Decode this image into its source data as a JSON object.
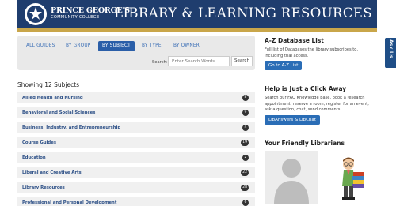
{
  "header": {
    "logo_name": "PRINCE GEORGE'S",
    "logo_subtitle": "COMMUNITY COLLEGE",
    "site_title": "LIBRARY & LEARNING RESOURCES",
    "colors": {
      "header_bg": "#1f3d6e",
      "accent_gold": "#c9a64a"
    }
  },
  "filter": {
    "tabs": [
      {
        "label": "ALL GUIDES"
      },
      {
        "label": "BY GROUP"
      },
      {
        "label": "BY SUBJECT",
        "active": true
      },
      {
        "label": "BY TYPE"
      },
      {
        "label": "BY OWNER"
      }
    ],
    "search_label": "Search:",
    "search_placeholder": "Enter Search Words",
    "search_button": "Search"
  },
  "subjects": {
    "heading": "Showing 12 Subjects",
    "items": [
      {
        "label": "Allied Health and Nursing",
        "count": "8"
      },
      {
        "label": "Behavioral and Social Sciences",
        "count": "9"
      },
      {
        "label": "Business, Industry, and Entrepreneurship",
        "count": "4"
      },
      {
        "label": "Course Guides",
        "count": "19"
      },
      {
        "label": "Education",
        "count": "2"
      },
      {
        "label": "Liberal and Creative Arts",
        "count": "22"
      },
      {
        "label": "Library Resources",
        "count": "28"
      },
      {
        "label": "Professional and Personal Development",
        "count": "6"
      }
    ]
  },
  "sidebar": {
    "az": {
      "heading": "A-Z Database List",
      "text": "Full list of Databases the library subscribes to, including trial access.",
      "button": "Go to A-Z List"
    },
    "help": {
      "heading": "Help is Just a Click Away",
      "text": "Search our FAQ Knowledge base, book a research appointment, reserve a room, register for an event, ask a question, chat, send comments...",
      "button": "LibAnswers & LibChat"
    },
    "librarians": {
      "heading": "Your Friendly Librarians"
    }
  },
  "chat_tab": {
    "label": "Ask Us"
  }
}
